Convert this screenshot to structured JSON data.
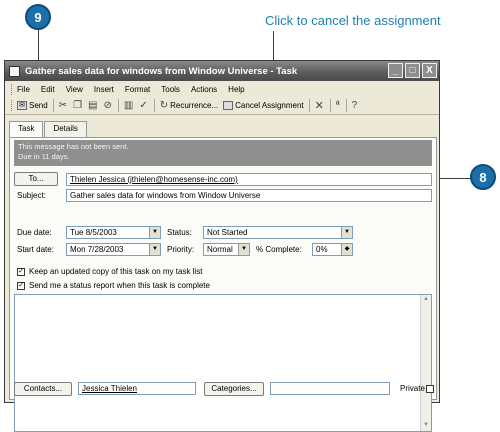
{
  "callouts": {
    "top_text": "Click to cancel the assignment",
    "step_9": "9",
    "step_8": "8"
  },
  "window": {
    "title": "Gather sales data for windows from Window Universe - Task",
    "minimize": "_",
    "maximize": "□",
    "close": "X"
  },
  "menu": [
    "File",
    "Edit",
    "View",
    "Insert",
    "Format",
    "Tools",
    "Actions",
    "Help"
  ],
  "toolbar": {
    "send": "Send",
    "recurrence": "Recurrence...",
    "cancel_assignment": "Cancel Assignment"
  },
  "tabs": [
    "Task",
    "Details"
  ],
  "info": {
    "line1": "This message has not been sent.",
    "line2": "Due in 11 days."
  },
  "form": {
    "to_button": "To...",
    "to_value": "Thielen Jessica (jthielen@homesense-inc.com)",
    "subject_label": "Subject:",
    "subject_value": "Gather sales data for windows from Window Universe",
    "due_date_label": "Due date:",
    "due_date_value": "Tue 8/5/2003",
    "start_date_label": "Start date:",
    "start_date_value": "Mon 7/28/2003",
    "status_label": "Status:",
    "status_value": "Not Started",
    "priority_label": "Priority:",
    "priority_value": "Normal",
    "complete_label": "% Complete:",
    "complete_value": "0%",
    "keep_copy_label": "Keep an updated copy of this task on my task list",
    "status_report_label": "Send me a status report when this task is complete",
    "contacts_button": "Contacts...",
    "contacts_value": "Jessica Thielen",
    "categories_button": "Categories...",
    "categories_value": "",
    "private_label": "Private"
  }
}
